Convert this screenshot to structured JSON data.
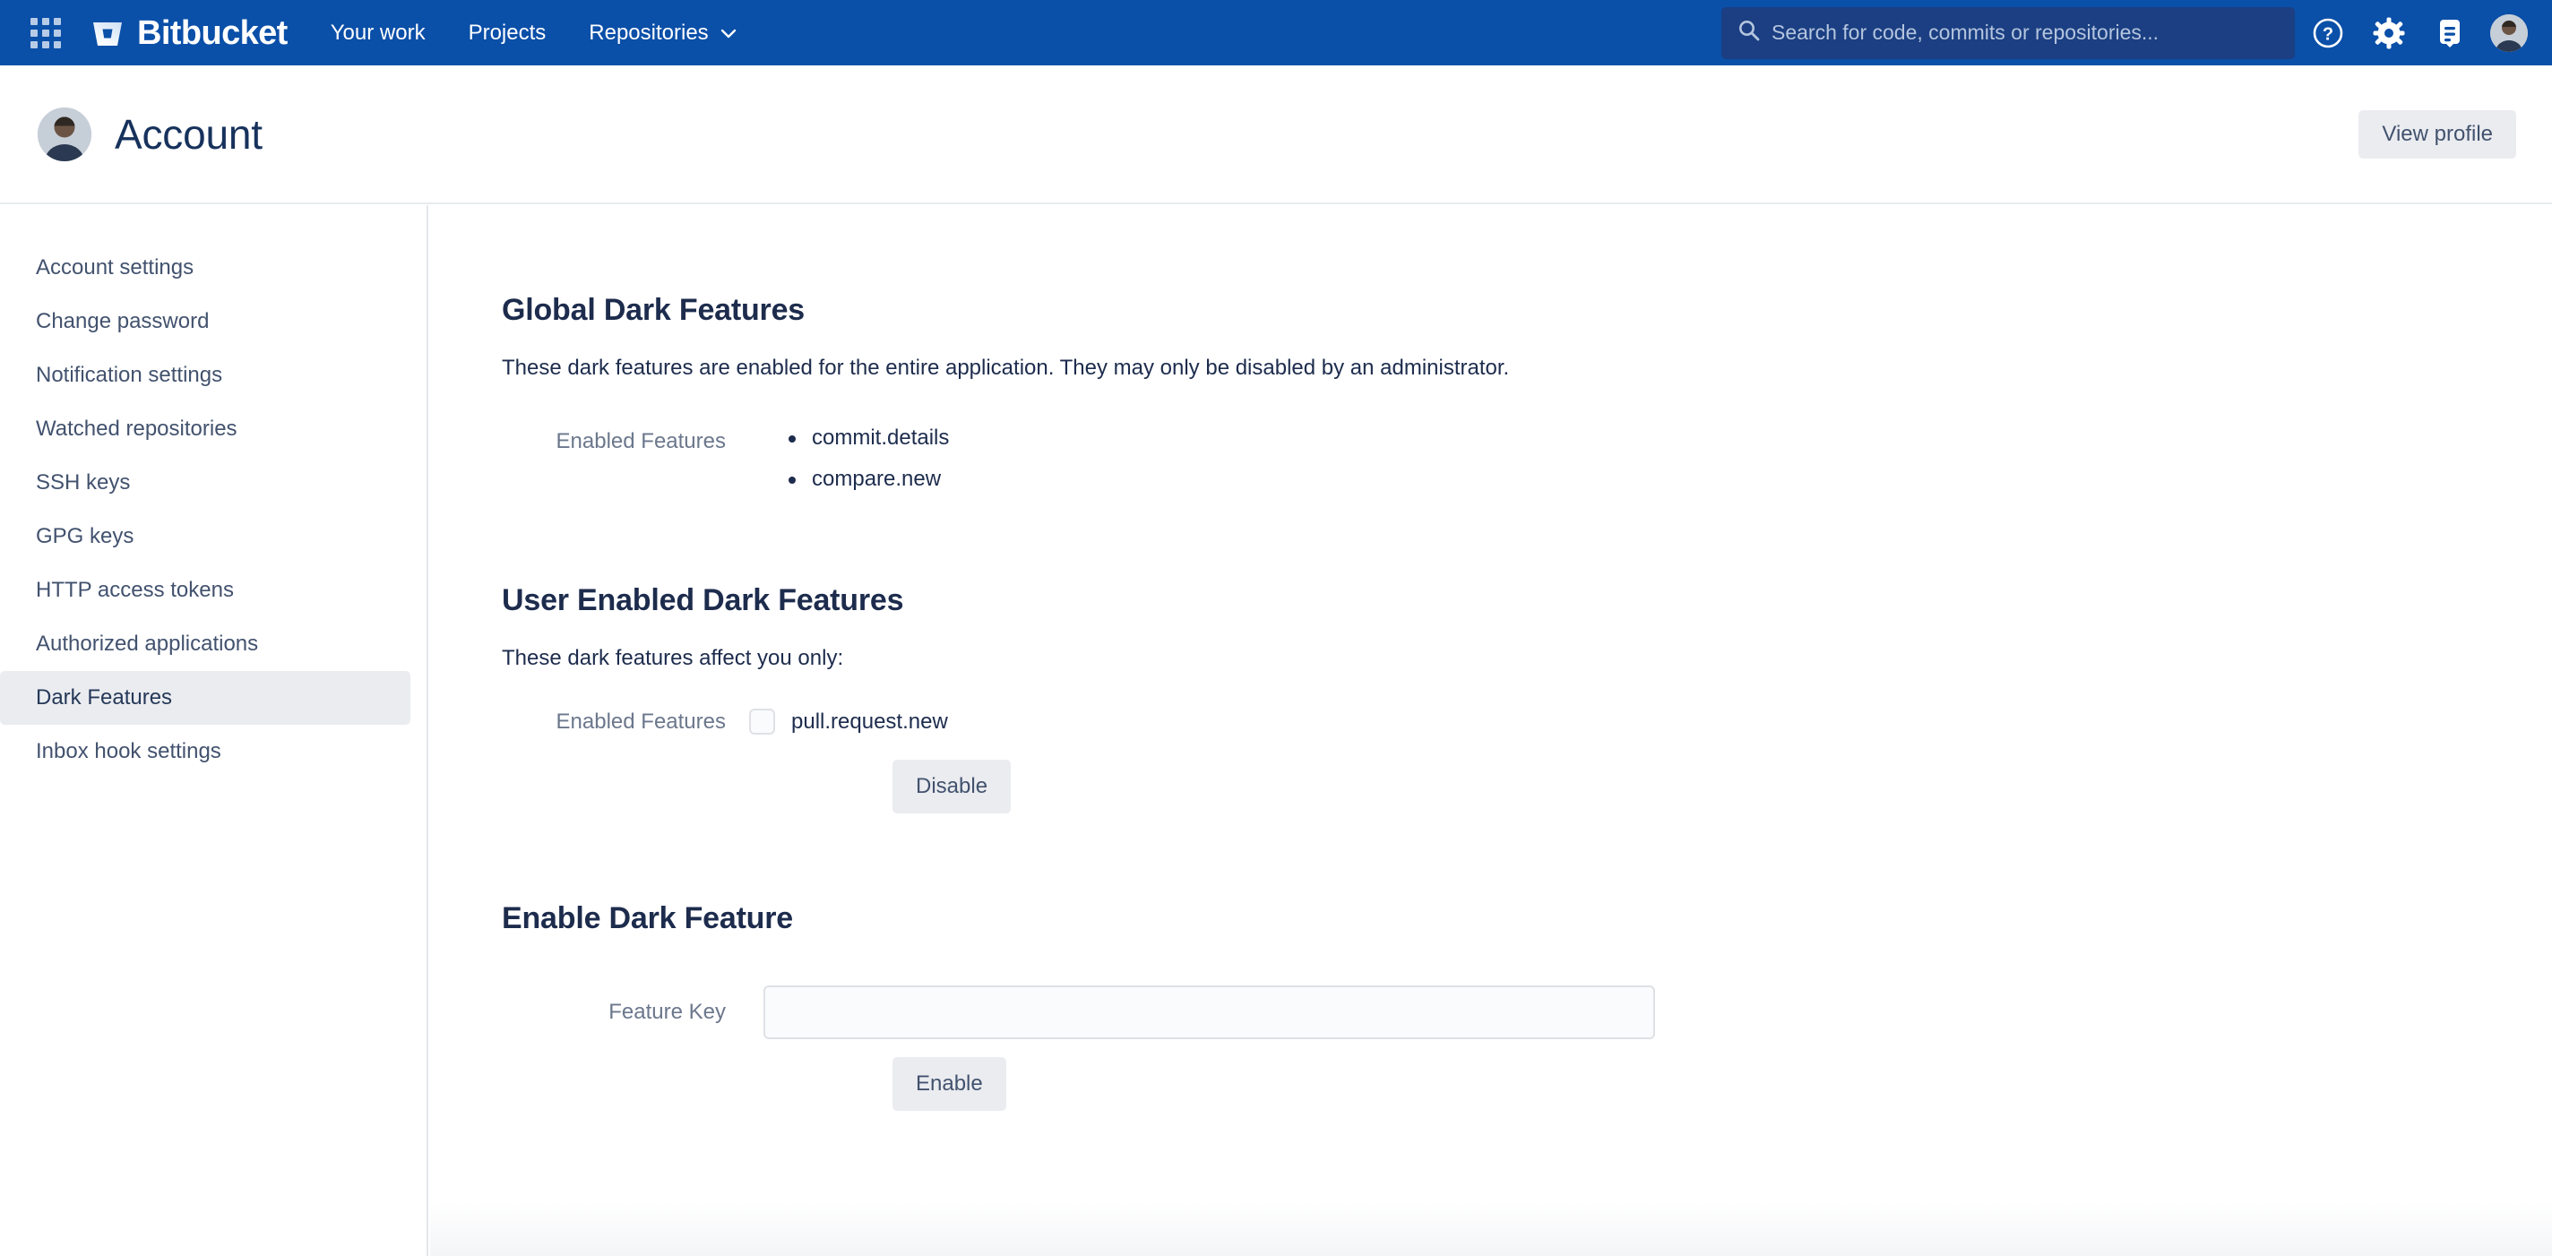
{
  "topnav": {
    "app_switcher_icon": "app-switcher-grid-icon",
    "brand": {
      "logo_icon": "bitbucket-logo-icon",
      "name": "Bitbucket"
    },
    "links": [
      {
        "label": "Your work",
        "has_chevron": false
      },
      {
        "label": "Projects",
        "has_chevron": false
      },
      {
        "label": "Repositories",
        "has_chevron": true,
        "chevron": "⌄"
      }
    ],
    "search": {
      "icon": "search-icon",
      "placeholder": "Search for code, commits or repositories...",
      "value": ""
    },
    "icons": [
      {
        "name": "help-icon",
        "glyph": "?"
      },
      {
        "name": "settings-gear-icon",
        "glyph": "gear"
      },
      {
        "name": "inbox-notifications-icon",
        "glyph": "inbox"
      }
    ],
    "avatar": "user-avatar"
  },
  "header": {
    "avatar": "account-avatar",
    "title": "Account",
    "view_profile_label": "View profile"
  },
  "sidebar": {
    "items": [
      {
        "label": "Account settings",
        "selected": false
      },
      {
        "label": "Change password",
        "selected": false
      },
      {
        "label": "Notification settings",
        "selected": false
      },
      {
        "label": "Watched repositories",
        "selected": false
      },
      {
        "label": "SSH keys",
        "selected": false
      },
      {
        "label": "GPG keys",
        "selected": false
      },
      {
        "label": "HTTP access tokens",
        "selected": false
      },
      {
        "label": "Authorized applications",
        "selected": false
      },
      {
        "label": "Dark Features",
        "selected": true
      },
      {
        "label": "Inbox hook settings",
        "selected": false
      }
    ]
  },
  "main": {
    "global": {
      "title": "Global Dark Features",
      "description": "These dark features are enabled for the entire application. They may only be disabled by an administrator.",
      "label": "Enabled Features",
      "features": [
        "commit.details",
        "compare.new"
      ]
    },
    "user": {
      "title": "User Enabled Dark Features",
      "description": "These dark features affect you only:",
      "label": "Enabled Features",
      "feature": "pull.request.new",
      "checked": false,
      "disable_label": "Disable"
    },
    "enable": {
      "title": "Enable Dark Feature",
      "label": "Feature Key",
      "input_value": "",
      "input_placeholder": "",
      "enable_label": "Enable"
    }
  },
  "colors": {
    "nav_blue": "#0a4fa8",
    "search_bg": "#1b3f82",
    "heading": "#1d2c4d",
    "muted_label": "#6b778c",
    "button_bg": "#ebecf0",
    "selected_bg": "#ebecf0"
  }
}
